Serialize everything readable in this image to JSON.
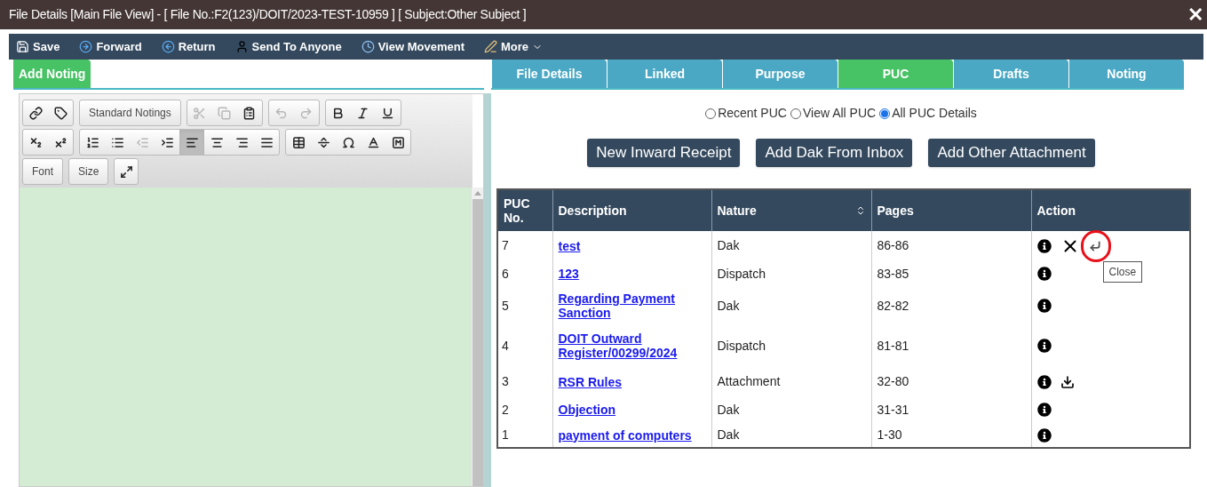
{
  "window": {
    "title": "File Details [Main File View] - [ File No.:F2(123)/DOIT/2023-TEST-10959 ] [ Subject:Other Subject ]",
    "close": "✕"
  },
  "toolbar": [
    {
      "kind": "save",
      "label": "Save"
    },
    {
      "kind": "forward",
      "label": "Forward"
    },
    {
      "kind": "return",
      "label": "Return"
    },
    {
      "kind": "send",
      "label": "Send To Anyone"
    },
    {
      "kind": "movement",
      "label": "View Movement"
    },
    {
      "kind": "more",
      "label": "More"
    }
  ],
  "left_tab": {
    "label": "Add Noting",
    "selected": true
  },
  "tabs": [
    {
      "label": "File Details",
      "selected": false
    },
    {
      "label": "Linked",
      "selected": false
    },
    {
      "label": "Purpose",
      "selected": false
    },
    {
      "label": "PUC",
      "selected": true
    },
    {
      "label": "Drafts",
      "selected": false
    },
    {
      "label": "Noting",
      "selected": false
    }
  ],
  "editor": {
    "rows": [
      [
        [
          {
            "kind": "link",
            "disabled": false,
            "active": false
          },
          {
            "kind": "tag",
            "disabled": false,
            "active": false
          }
        ],
        [
          {
            "kind": "text",
            "label": "Standard Notings"
          }
        ],
        [
          {
            "kind": "cut",
            "disabled": true,
            "active": false
          },
          {
            "kind": "copy",
            "disabled": true,
            "active": false
          },
          {
            "kind": "paste",
            "disabled": false,
            "active": false
          }
        ],
        [
          {
            "kind": "undo",
            "disabled": true,
            "active": false
          },
          {
            "kind": "redo",
            "disabled": true,
            "active": false
          }
        ],
        [
          {
            "kind": "bold",
            "disabled": false,
            "active": false
          },
          {
            "kind": "italic",
            "disabled": false,
            "active": false
          },
          {
            "kind": "underline",
            "disabled": false,
            "active": false
          }
        ]
      ],
      [
        [
          {
            "kind": "subscript",
            "disabled": false,
            "active": false
          },
          {
            "kind": "superscript",
            "disabled": false,
            "active": false
          }
        ],
        [
          {
            "kind": "ordered",
            "disabled": false,
            "active": false
          },
          {
            "kind": "bullets",
            "disabled": false,
            "active": false
          },
          {
            "kind": "outdent",
            "disabled": true,
            "active": false
          },
          {
            "kind": "indent",
            "disabled": false,
            "active": false
          },
          {
            "kind": "align-left",
            "disabled": false,
            "active": true
          },
          {
            "kind": "align-center",
            "disabled": false,
            "active": false
          },
          {
            "kind": "align-right",
            "disabled": false,
            "active": false
          },
          {
            "kind": "justify",
            "disabled": false,
            "active": false
          }
        ],
        [
          {
            "kind": "table",
            "disabled": false,
            "active": false
          },
          {
            "kind": "rule",
            "disabled": false,
            "active": false
          },
          {
            "kind": "omega",
            "disabled": false,
            "active": false
          },
          {
            "kind": "text-color",
            "disabled": false,
            "active": false
          },
          {
            "kind": "bg-color",
            "disabled": false,
            "active": false
          }
        ]
      ],
      [
        [
          {
            "kind": "text",
            "label": "Font"
          }
        ],
        [
          {
            "kind": "text",
            "label": "Size"
          }
        ],
        [
          {
            "kind": "maximize",
            "disabled": false,
            "active": false
          }
        ]
      ]
    ]
  },
  "puc_view": [
    {
      "label": "Recent PUC",
      "selected": false
    },
    {
      "label": "View All PUC",
      "selected": false
    },
    {
      "label": "All PUC Details",
      "selected": true
    }
  ],
  "buttons": [
    "New Inward Receipt",
    "Add Dak From Inbox",
    "Add Other Attachment"
  ],
  "table": {
    "columns": [
      "PUC No.",
      "Description",
      "Nature",
      "Pages",
      "Action"
    ],
    "rows": [
      {
        "no": "7",
        "description": "test",
        "nature": "Dak",
        "pages": "86-86",
        "actions": [
          {
            "kind": "info"
          },
          {
            "kind": "delete"
          },
          {
            "kind": "return",
            "highlighted": true,
            "tooltip": "Close"
          }
        ]
      },
      {
        "no": "6",
        "description": "123",
        "nature": "Dispatch",
        "pages": "83-85",
        "actions": [
          {
            "kind": "info"
          }
        ]
      },
      {
        "no": "5",
        "description": "Regarding Payment Sanction",
        "nature": "Dak",
        "pages": "82-82",
        "actions": [
          {
            "kind": "info"
          }
        ]
      },
      {
        "no": "4",
        "description": "DOIT Outward Register/00299/2024",
        "nature": "Dispatch",
        "pages": "81-81",
        "actions": [
          {
            "kind": "info"
          }
        ]
      },
      {
        "no": "3",
        "description": "RSR Rules",
        "nature": "Attachment",
        "pages": "32-80",
        "actions": [
          {
            "kind": "info"
          },
          {
            "kind": "download"
          }
        ]
      },
      {
        "no": "2",
        "description": "Objection",
        "nature": "Dak",
        "pages": "31-31",
        "actions": [
          {
            "kind": "info"
          }
        ]
      },
      {
        "no": "1",
        "description": "payment of computers",
        "nature": "Dak",
        "pages": "1-30",
        "actions": [
          {
            "kind": "info"
          }
        ]
      }
    ]
  }
}
